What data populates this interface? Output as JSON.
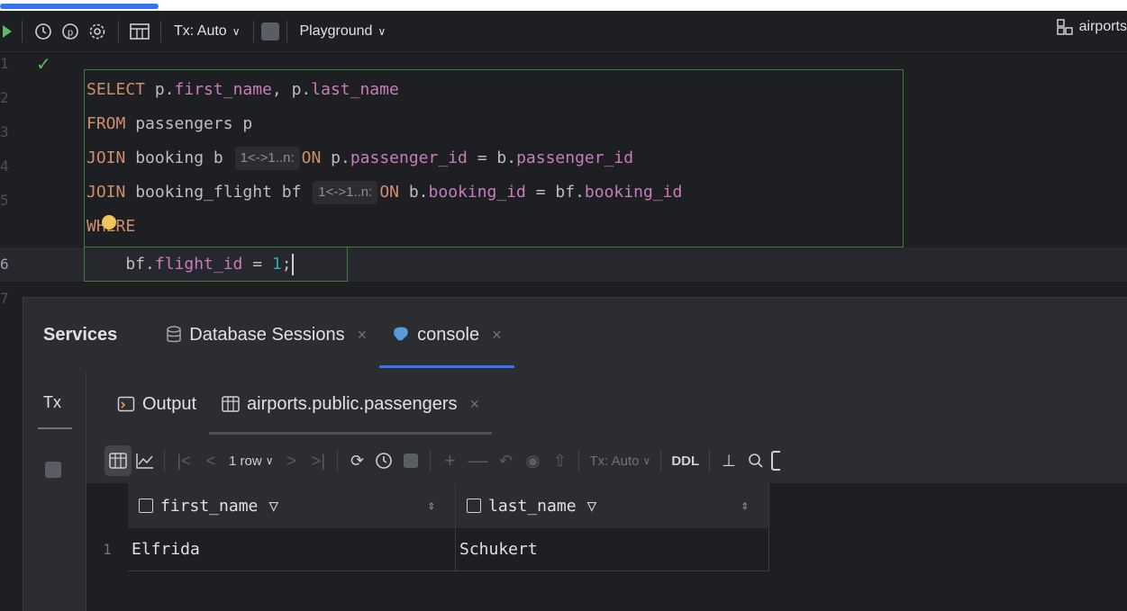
{
  "toolbar": {
    "tx_mode": "Tx: Auto",
    "playground": "Playground",
    "datasource": "airports"
  },
  "editor": {
    "lines": [
      {
        "num": "1"
      },
      {
        "num": "2"
      },
      {
        "num": "3"
      },
      {
        "num": "4"
      },
      {
        "num": "5"
      },
      {
        "num": "6"
      },
      {
        "num": "7"
      }
    ],
    "hints": {
      "join1": "1<->1..n:",
      "join2": "1<->1..n:"
    },
    "code": {
      "l1_kw": "SELECT",
      "l1_a": " p.",
      "l1_f1": "first_name",
      "l1_b": ", p.",
      "l1_f2": "last_name",
      "l2_kw": "FROM",
      "l2_a": " passengers p",
      "l3_kw": "JOIN",
      "l3_a": " booking b ",
      "l3_kw2": "ON",
      "l3_b": " p.",
      "l3_f1": "passenger_id",
      "l3_c": " = b.",
      "l3_f2": "passenger_id",
      "l4_kw": "JOIN",
      "l4_a": " booking_flight bf ",
      "l4_kw2": "ON",
      "l4_b": " b.",
      "l4_f1": "booking_id",
      "l4_c": " = bf.",
      "l4_f2": "booking_id",
      "l5_kw": "WHERE",
      "l6_a": "    bf.",
      "l6_f1": "flight_id",
      "l6_b": " = ",
      "l6_num": "1",
      "l6_c": ";"
    }
  },
  "services": {
    "title": "Services",
    "tabs": [
      {
        "label": "Database Sessions"
      },
      {
        "label": "console"
      }
    ],
    "rail_label": "Tx",
    "sub_tabs": [
      {
        "label": "Output"
      },
      {
        "label": "airports.public.passengers"
      }
    ],
    "results_toolbar": {
      "row_count": "1 row",
      "tx_mode": "Tx: Auto",
      "ddl": "DDL"
    },
    "grid": {
      "columns": [
        {
          "name": "first_name"
        },
        {
          "name": "last_name"
        }
      ],
      "rows": [
        {
          "num": "1",
          "cells": [
            "Elfrida",
            "Schukert"
          ]
        }
      ]
    }
  }
}
